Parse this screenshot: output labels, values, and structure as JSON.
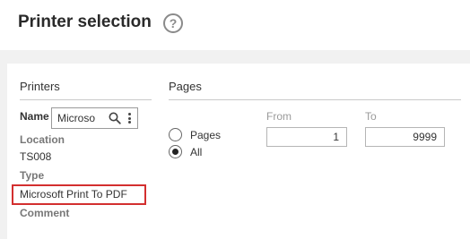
{
  "header": {
    "title": "Printer selection",
    "help_glyph": "?"
  },
  "printers": {
    "section_title": "Printers",
    "name_label": "Name",
    "name_value": "Microsoft Print To PDF",
    "name_visible": "Microso",
    "location_label": "Location",
    "location_value": "TS008",
    "type_label": "Type",
    "type_value": "Microsoft Print To PDF",
    "comment_label": "Comment"
  },
  "pages": {
    "section_title": "Pages",
    "from_label": "From",
    "to_label": "To",
    "from_value": "1",
    "to_value": "9999",
    "options": [
      {
        "label": "Pages",
        "selected": false
      },
      {
        "label": "All",
        "selected": true
      }
    ]
  },
  "colors": {
    "highlight": "#d32f2f"
  }
}
